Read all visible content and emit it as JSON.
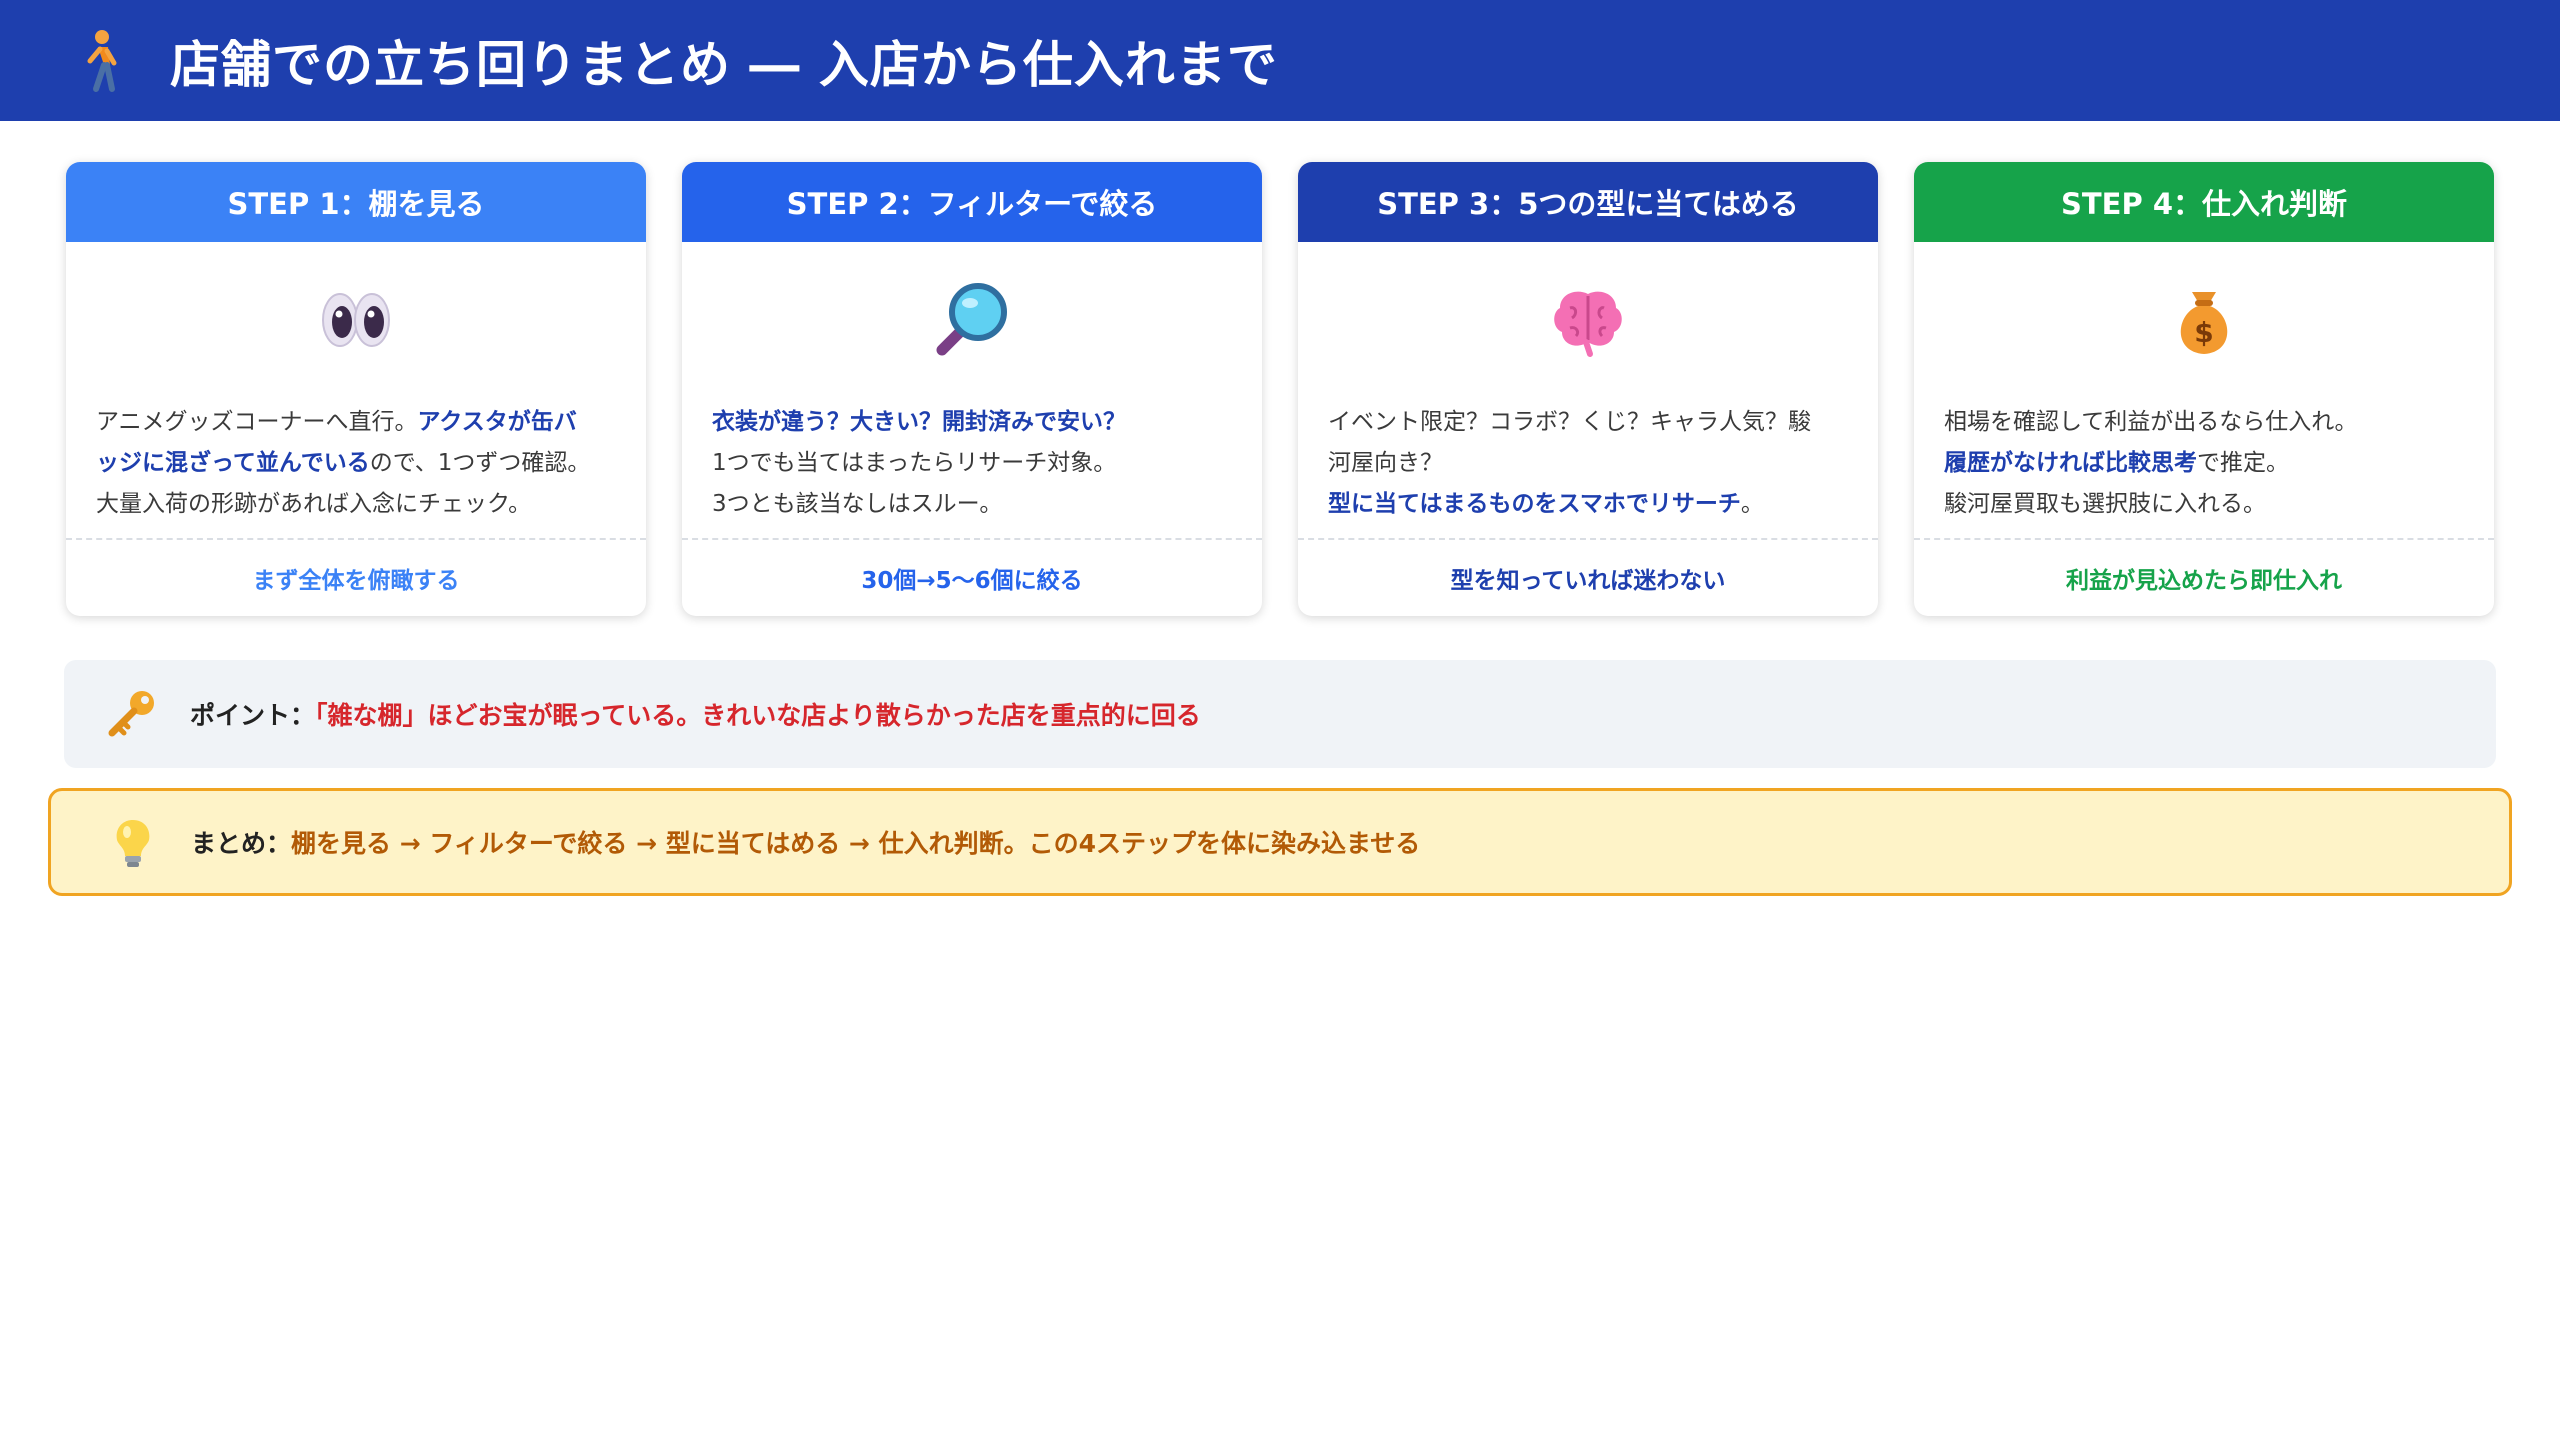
{
  "header": {
    "icon": "walking-person-icon",
    "title": "店舗での立ち回りまとめ ― 入店から仕入れまで"
  },
  "colors": {
    "header_bg": "#1e3fae",
    "step1": "#3b82f6",
    "step2": "#2563eb",
    "step3": "#1e3fae",
    "step4": "#16a34a",
    "highlight": "#1e3fae",
    "point_red": "#d6262c",
    "summary_orange": "#b25a06"
  },
  "steps": [
    {
      "title": "STEP 1：棚を見る",
      "icon": "eyes-icon",
      "lines": [
        [
          {
            "t": "アニメグッズコーナーへ直行。"
          },
          {
            "t": "アクスタが缶バ",
            "hl": true
          }
        ],
        [
          {
            "t": "ッジに混ざって並んでいる",
            "hl": true
          },
          {
            "t": "ので、1つずつ確認。"
          }
        ],
        [
          {
            "t": "大量入荷の形跡があれば入念にチェック。"
          }
        ]
      ],
      "footer": "まず全体を俯瞰する"
    },
    {
      "title": "STEP 2：フィルターで絞る",
      "icon": "magnifying-glass-icon",
      "lines": [
        [
          {
            "t": "衣装が違う？大きい？開封済みで安い？",
            "hl": true
          }
        ],
        [
          {
            "t": "1つでも当てはまったらリサーチ対象。"
          }
        ],
        [
          {
            "t": "3つとも該当なしはスルー。"
          }
        ]
      ],
      "footer": "30個→5〜6個に絞る"
    },
    {
      "title": "STEP 3：5つの型に当てはめる",
      "icon": "brain-icon",
      "lines": [
        [
          {
            "t": "イベント限定？コラボ？くじ？キャラ人気？駿"
          }
        ],
        [
          {
            "t": "河屋向き？"
          }
        ],
        [
          {
            "t": "型に当てはまるものをスマホでリサーチ",
            "hl": true
          },
          {
            "t": "。"
          }
        ]
      ],
      "footer": "型を知っていれば迷わない"
    },
    {
      "title": "STEP 4：仕入れ判断",
      "icon": "money-bag-icon",
      "lines": [
        [
          {
            "t": "相場を確認して利益が出るなら仕入れ。"
          }
        ],
        [
          {
            "t": "履歴がなければ比較思考",
            "hl": true
          },
          {
            "t": "で推定。"
          }
        ],
        [
          {
            "t": "駿河屋買取も選択肢に入れる。"
          }
        ]
      ],
      "footer": "利益が見込めたら即仕入れ"
    }
  ],
  "point": {
    "icon": "key-icon",
    "label": "ポイント：",
    "text": "「雑な棚」ほどお宝が眠っている。きれいな店より散らかった店を重点的に回る"
  },
  "summary": {
    "icon": "light-bulb-icon",
    "label": "まとめ：",
    "text": "棚を見る → フィルターで絞る → 型に当てはめる → 仕入れ判断。この4ステップを体に染み込ませる"
  }
}
